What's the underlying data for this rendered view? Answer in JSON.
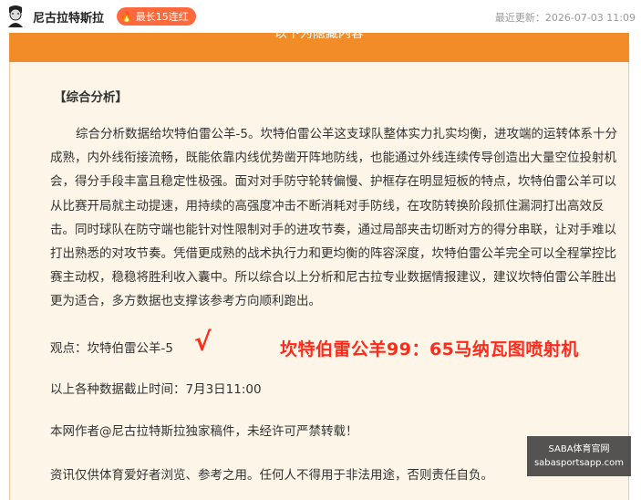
{
  "header": {
    "author": "尼古拉特斯拉",
    "badge": "最长15连红",
    "updated": "最近更新：2026-07-03 11:09"
  },
  "banner": {
    "text": "以下为隐藏内容"
  },
  "content": {
    "heading": "【综合分析】",
    "analysis": "综合分析数据给坎特伯雷公羊-5。坎特伯雷公羊这支球队整体实力扎实均衡，进攻端的运转体系十分成熟，内外线衔接流畅，既能依靠内线优势凿开阵地防线，也能通过外线连续传导创造出大量空位投射机会，得分手段丰富且稳定性极强。面对对手防守轮转偏慢、护框存在明显短板的特点，坎特伯雷公羊可以从比赛开局就主动提速，用持续的高强度冲击不断消耗对手防线，在攻防转换阶段抓住漏洞打出高效反击。同时球队在防守端也能针对性限制对手的进攻节奏，通过局部夹击切断对方的得分串联，让对手难以打出熟悉的对攻节奏。凭借更成熟的战术执行力和更均衡的阵容深度，坎特伯雷公羊完全可以全程掌控比赛主动权，稳稳将胜利收入囊中。所以综合以上分析和尼古拉专业数据情报建议，建议坎特伯雷公羊胜出更为适合，多方数据也支撑该参考方向顺利跑出。",
    "viewpoint": "观点：坎特伯雷公羊-5",
    "check": "√",
    "highlight": "坎特伯雷公羊99：65马纳瓦图喷射机",
    "deadline": "以上各种数据截止时间：7月3日11:00",
    "copyright": "本网作者@尼古拉特斯拉独家稿件，未经许可严禁转载！",
    "disclaimer": "资讯仅供体育爱好者浏览、参考之用。任何人不得用于非法用途，否则责任自负。"
  },
  "watermark": {
    "line1": "SABA体育官网",
    "line2": "sabasportsapp.com"
  },
  "colors": {
    "accent": "#f28c28",
    "badge": "#ff6a3d",
    "highlight": "#ff2a1a",
    "content_bg": "#fdf6e8"
  }
}
